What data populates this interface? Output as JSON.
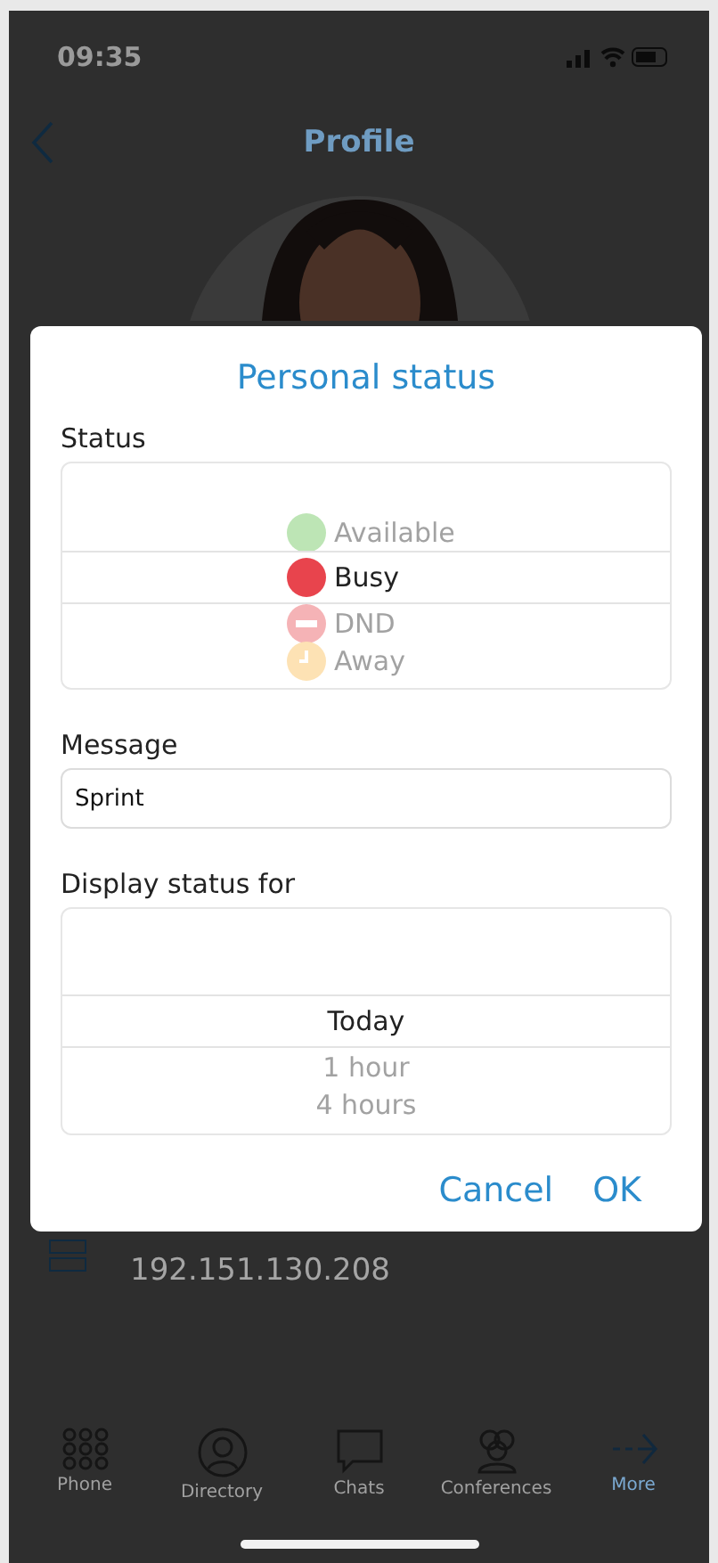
{
  "status_bar": {
    "time": "09:35"
  },
  "nav": {
    "title": "Profile"
  },
  "dialog": {
    "title": "Personal status",
    "status_label": "Status",
    "statuses": [
      {
        "name": "Available",
        "color": "#bde5b5",
        "kind": "plain",
        "selected": false
      },
      {
        "name": "Busy",
        "color": "#e8444d",
        "kind": "plain",
        "selected": true
      },
      {
        "name": "DND",
        "color": "#f5b3b6",
        "kind": "minus",
        "selected": false
      },
      {
        "name": "Away",
        "color": "#fde2b4",
        "kind": "clock",
        "selected": false
      }
    ],
    "message_label": "Message",
    "message": {
      "value": "Sprint"
    },
    "duration_label": "Display status for",
    "durations": [
      {
        "label": "Today",
        "selected": true
      },
      {
        "label": "1 hour",
        "selected": false
      },
      {
        "label": "4 hours",
        "selected": false
      }
    ],
    "buttons": [
      "Cancel",
      "OK"
    ]
  },
  "background_field": {
    "value": "192.151.130.208"
  },
  "tabs": [
    {
      "label": "Phone",
      "selected": false
    },
    {
      "label": "Directory",
      "selected": false
    },
    {
      "label": "Chats",
      "selected": false
    },
    {
      "label": "Conferences",
      "selected": false
    },
    {
      "label": "More",
      "selected": true
    }
  ]
}
